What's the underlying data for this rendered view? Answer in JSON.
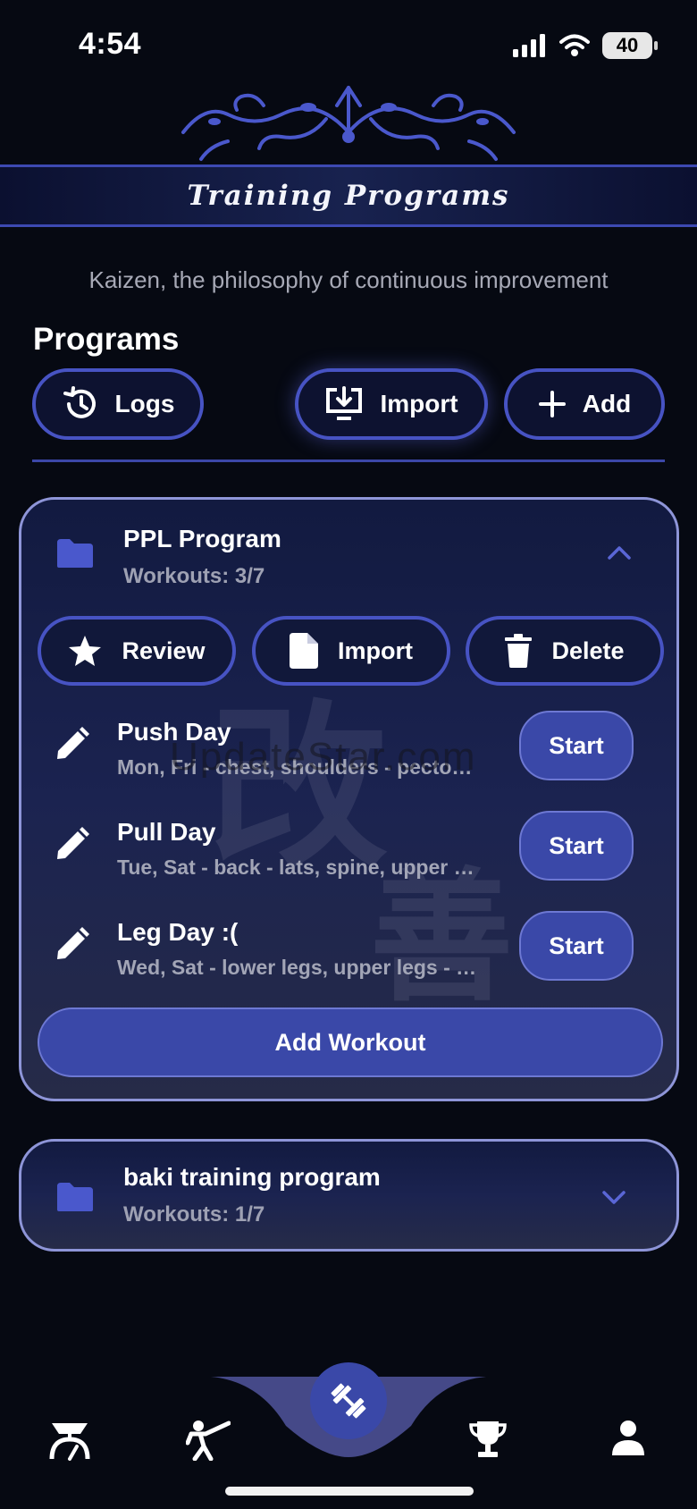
{
  "status_bar": {
    "time": "4:54",
    "battery": "40",
    "signal_icon": "cellular-signal-icon",
    "wifi_icon": "wifi-icon"
  },
  "header": {
    "title": "Training Programs",
    "ornament_icon": "ornament-flourish-icon"
  },
  "tagline": "Kaizen, the philosophy of continuous improvement",
  "programs_section": {
    "title": "Programs",
    "buttons": {
      "logs": "Logs",
      "import": "Import",
      "add": "Add"
    }
  },
  "programs": [
    {
      "name": "PPL Program",
      "workouts_count": "Workouts: 3/7",
      "expanded": true,
      "actions": {
        "review": "Review",
        "import": "Import",
        "delete": "Delete"
      },
      "workouts": [
        {
          "name": "Push Day",
          "description": "Mon, Fri - chest, shoulders - pecto…",
          "start_label": "Start"
        },
        {
          "name": "Pull Day",
          "description": "Tue, Sat  - back  - lats, spine, upper …",
          "start_label": "Start"
        },
        {
          "name": "Leg Day :(",
          "description": "Wed, Sat  - lower legs, upper legs  - …",
          "start_label": "Start"
        }
      ],
      "add_workout_label": "Add Workout"
    },
    {
      "name": "baki training program",
      "workouts_count": "Workouts: 1/7",
      "expanded": false
    }
  ],
  "watermark": "UpdateStar.com",
  "bottom_nav": {
    "items": [
      "scale-icon",
      "martial-arts-icon",
      "dumbbell-icon",
      "trophy-icon",
      "profile-icon"
    ],
    "active": "dumbbell-icon"
  },
  "colors": {
    "background": "#060912",
    "accent": "#3a48a8",
    "border": "#4753c3",
    "card_border": "#8e95d8",
    "folder": "#4a58cc"
  }
}
